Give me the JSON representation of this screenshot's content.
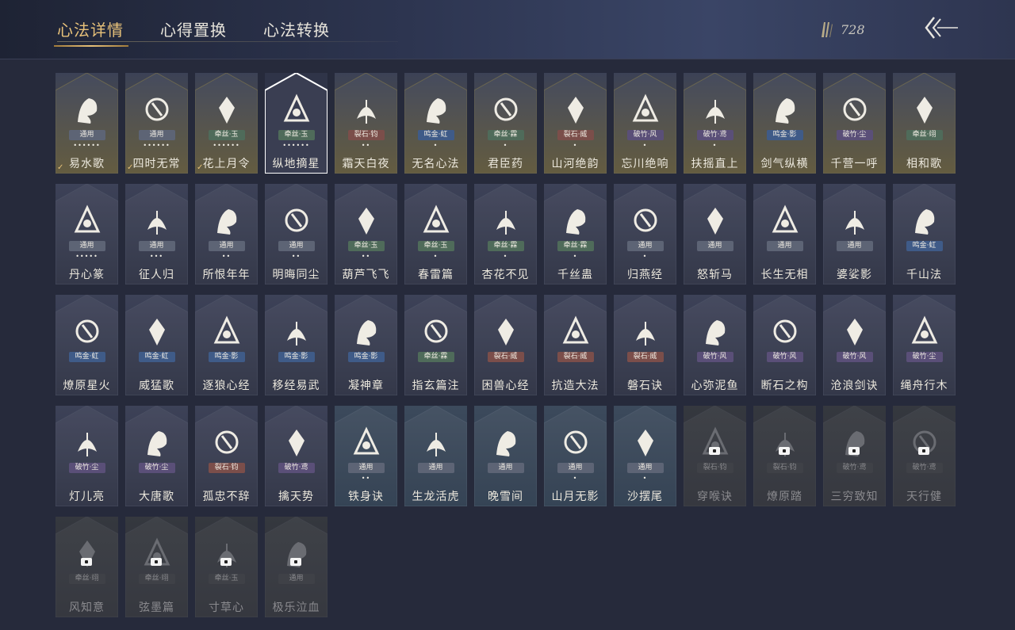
{
  "tabs": [
    {
      "label": "心法详情",
      "active": true
    },
    {
      "label": "心得置换",
      "active": false
    },
    {
      "label": "心法转换",
      "active": false
    }
  ],
  "currency": {
    "icon": "feather-currency-icon",
    "amount": "728"
  },
  "back": {
    "icon": "back-arrow-icon"
  },
  "tag_colors": {
    "通用": "#5d6475",
    "牵丝·玉": "#4f6b5a",
    "牵丝·霖": "#4f6b5a",
    "牵丝·翊": "#4f6b5a",
    "裂石·钧": "#7b4e4a",
    "裂石·威": "#7b4e4a",
    "鸣金·虹": "#3f5b88",
    "鸣金·影": "#3f5b88",
    "破竹·风": "#5a4f78",
    "破竹·鸢": "#5a4f78",
    "破竹·尘": "#5a4f78"
  },
  "cards": [
    {
      "name": "易水歌",
      "tag": "通用",
      "dots": "••••••",
      "style": "gold",
      "check": true,
      "icon": "horse-icon"
    },
    {
      "name": "四时无常",
      "tag": "通用",
      "dots": "••••••",
      "style": "gold",
      "check": true,
      "icon": "branch-icon"
    },
    {
      "name": "花上月令",
      "tag": "牵丝·玉",
      "dots": "••••••",
      "style": "gold",
      "check": true,
      "icon": "flower-icon"
    },
    {
      "name": "纵地摘星",
      "tag": "牵丝·玉",
      "dots": "••••••",
      "style": "selected",
      "check": false,
      "icon": "wolf-moon-icon"
    },
    {
      "name": "霜天白夜",
      "tag": "裂石·钧",
      "dots": "••",
      "style": "gold",
      "check": false,
      "icon": "spear-icon"
    },
    {
      "name": "无名心法",
      "tag": "鸣金·虹",
      "dots": "•",
      "style": "gold",
      "check": false,
      "icon": "sword-icon"
    },
    {
      "name": "君臣药",
      "tag": "牵丝·霖",
      "dots": "•",
      "style": "gold",
      "check": false,
      "icon": "medicine-icon"
    },
    {
      "name": "山河绝韵",
      "tag": "裂石·威",
      "dots": "•",
      "style": "gold",
      "check": false,
      "icon": "mountain-icon"
    },
    {
      "name": "忘川绝响",
      "tag": "破竹·风",
      "dots": "•",
      "style": "gold",
      "check": false,
      "icon": "mask-icon"
    },
    {
      "name": "扶摇直上",
      "tag": "破竹·鸢",
      "dots": "•",
      "style": "gold",
      "check": false,
      "icon": "eagle-icon"
    },
    {
      "name": "剑气纵横",
      "tag": "鸣金·影",
      "dots": "",
      "style": "gold",
      "check": false,
      "icon": "swords-icon"
    },
    {
      "name": "千营一呼",
      "tag": "破竹·尘",
      "dots": "",
      "style": "gold",
      "check": false,
      "icon": "flag-icon"
    },
    {
      "name": "相和歌",
      "tag": "牵丝·翊",
      "dots": "",
      "style": "gold",
      "check": false,
      "icon": "cloud-icon"
    },
    {
      "name": "丹心篆",
      "tag": "通用",
      "dots": "•••••",
      "style": "normal",
      "check": false,
      "icon": "seal-icon"
    },
    {
      "name": "征人归",
      "tag": "通用",
      "dots": "•••",
      "style": "normal",
      "check": false,
      "icon": "hand-bird-icon"
    },
    {
      "name": "所恨年年",
      "tag": "通用",
      "dots": "••",
      "style": "normal",
      "check": false,
      "icon": "bamboo-icon"
    },
    {
      "name": "明晦同尘",
      "tag": "通用",
      "dots": "••",
      "style": "normal",
      "check": false,
      "icon": "snake-icon"
    },
    {
      "name": "葫芦飞飞",
      "tag": "牵丝·玉",
      "dots": "••",
      "style": "normal",
      "check": false,
      "icon": "gourd-icon"
    },
    {
      "name": "春雷篇",
      "tag": "牵丝·玉",
      "dots": "•",
      "style": "normal",
      "check": false,
      "icon": "tree-lightning-icon"
    },
    {
      "name": "杏花不见",
      "tag": "牵丝·霖",
      "dots": "•",
      "style": "normal",
      "check": false,
      "icon": "apricot-flower-icon"
    },
    {
      "name": "千丝蛊",
      "tag": "牵丝·霖",
      "dots": "•",
      "style": "normal",
      "check": false,
      "icon": "leaf-icon"
    },
    {
      "name": "归燕经",
      "tag": "通用",
      "dots": "•",
      "style": "normal",
      "check": false,
      "icon": "swallow-icon"
    },
    {
      "name": "怒斩马",
      "tag": "通用",
      "dots": "",
      "style": "normal",
      "check": false,
      "icon": "blade-icon"
    },
    {
      "name": "长生无相",
      "tag": "通用",
      "dots": "",
      "style": "normal",
      "check": false,
      "icon": "monk-icon"
    },
    {
      "name": "婆娑影",
      "tag": "通用",
      "dots": "",
      "style": "normal",
      "check": false,
      "icon": "dragon-icon"
    },
    {
      "name": "千山法",
      "tag": "鸣金·虹",
      "dots": "",
      "style": "normal",
      "check": false,
      "icon": "mountains-icon"
    },
    {
      "name": "燎原星火",
      "tag": "鸣金·虹",
      "dots": "",
      "style": "normal",
      "check": false,
      "icon": "scythe-icon"
    },
    {
      "name": "威猛歌",
      "tag": "鸣金·虹",
      "dots": "",
      "style": "normal",
      "check": false,
      "icon": "fist-icon"
    },
    {
      "name": "逐狼心经",
      "tag": "鸣金·影",
      "dots": "",
      "style": "normal",
      "check": false,
      "icon": "wolf-icon"
    },
    {
      "name": "移经易武",
      "tag": "鸣金·影",
      "dots": "",
      "style": "normal",
      "check": false,
      "icon": "armor-icon"
    },
    {
      "name": "凝神章",
      "tag": "鸣金·影",
      "dots": "",
      "style": "normal",
      "check": false,
      "icon": "bow-icon"
    },
    {
      "name": "指玄篇注",
      "tag": "牵丝·霖",
      "dots": "",
      "style": "normal",
      "check": false,
      "icon": "yin-yang-icon"
    },
    {
      "name": "困兽心经",
      "tag": "裂石·威",
      "dots": "",
      "style": "normal",
      "check": false,
      "icon": "cage-icon"
    },
    {
      "name": "抗造大法",
      "tag": "裂石·威",
      "dots": "",
      "style": "normal",
      "check": false,
      "icon": "bell-icon"
    },
    {
      "name": "磐石诀",
      "tag": "裂石·威",
      "dots": "",
      "style": "normal",
      "check": false,
      "icon": "rock-icon"
    },
    {
      "name": "心弥泥鱼",
      "tag": "破竹·风",
      "dots": "",
      "style": "normal",
      "check": false,
      "icon": "fish-icon"
    },
    {
      "name": "断石之构",
      "tag": "破竹·风",
      "dots": "",
      "style": "normal",
      "check": false,
      "icon": "warrior-icon"
    },
    {
      "name": "沧浪剑诀",
      "tag": "破竹·风",
      "dots": "",
      "style": "normal",
      "check": false,
      "icon": "serpent-icon"
    },
    {
      "name": "绳舟行木",
      "tag": "破竹·尘",
      "dots": "",
      "style": "normal",
      "check": false,
      "icon": "roots-icon"
    },
    {
      "name": "灯儿亮",
      "tag": "破竹·尘",
      "dots": "",
      "style": "normal",
      "check": false,
      "icon": "lantern-icon"
    },
    {
      "name": "大唐歌",
      "tag": "破竹·尘",
      "dots": "",
      "style": "normal",
      "check": false,
      "icon": "palace-icon"
    },
    {
      "name": "孤忠不辞",
      "tag": "裂石·钧",
      "dots": "",
      "style": "normal",
      "check": false,
      "icon": "hat-sword-icon"
    },
    {
      "name": "擒天势",
      "tag": "破竹·鸢",
      "dots": "",
      "style": "normal",
      "check": false,
      "icon": "chain-beast-icon"
    },
    {
      "name": "铁身诀",
      "tag": "通用",
      "dots": "••",
      "style": "blue",
      "check": false,
      "icon": "strongman-icon"
    },
    {
      "name": "生龙活虎",
      "tag": "通用",
      "dots": "",
      "style": "blue",
      "check": false,
      "icon": "runner-icon"
    },
    {
      "name": "晚雪间",
      "tag": "通用",
      "dots": "",
      "style": "blue",
      "check": false,
      "icon": "anchor-icon"
    },
    {
      "name": "山月无影",
      "tag": "通用",
      "dots": "•",
      "style": "blue",
      "check": false,
      "icon": "claw-icon"
    },
    {
      "name": "沙摆尾",
      "tag": "通用",
      "dots": "•",
      "style": "blue",
      "check": false,
      "icon": "wave-icon"
    },
    {
      "name": "穿喉诀",
      "tag": "裂石·钧",
      "dots": "",
      "style": "locked",
      "check": false,
      "icon": "dragon-head-icon"
    },
    {
      "name": "燎原踏",
      "tag": "裂石·钧",
      "dots": "",
      "style": "locked",
      "check": false,
      "icon": "rider-icon"
    },
    {
      "name": "三穷致知",
      "tag": "破竹·鸢",
      "dots": "",
      "style": "locked",
      "check": false,
      "icon": "scroll-icon"
    },
    {
      "name": "天行健",
      "tag": "破竹·鸢",
      "dots": "",
      "style": "locked",
      "check": false,
      "icon": "straw-hat-icon"
    },
    {
      "name": "风知意",
      "tag": "牵丝·翊",
      "dots": "",
      "style": "locked",
      "check": false,
      "icon": "bird-bell-icon"
    },
    {
      "name": "弦墨篇",
      "tag": "牵丝·翊",
      "dots": "",
      "style": "locked",
      "check": false,
      "icon": "brush-icon"
    },
    {
      "name": "寸草心",
      "tag": "牵丝·玉",
      "dots": "",
      "style": "locked",
      "check": false,
      "icon": "peach-icon"
    },
    {
      "name": "极乐泣血",
      "tag": "通用",
      "dots": "",
      "style": "locked",
      "check": false,
      "icon": "eye-icon"
    }
  ]
}
